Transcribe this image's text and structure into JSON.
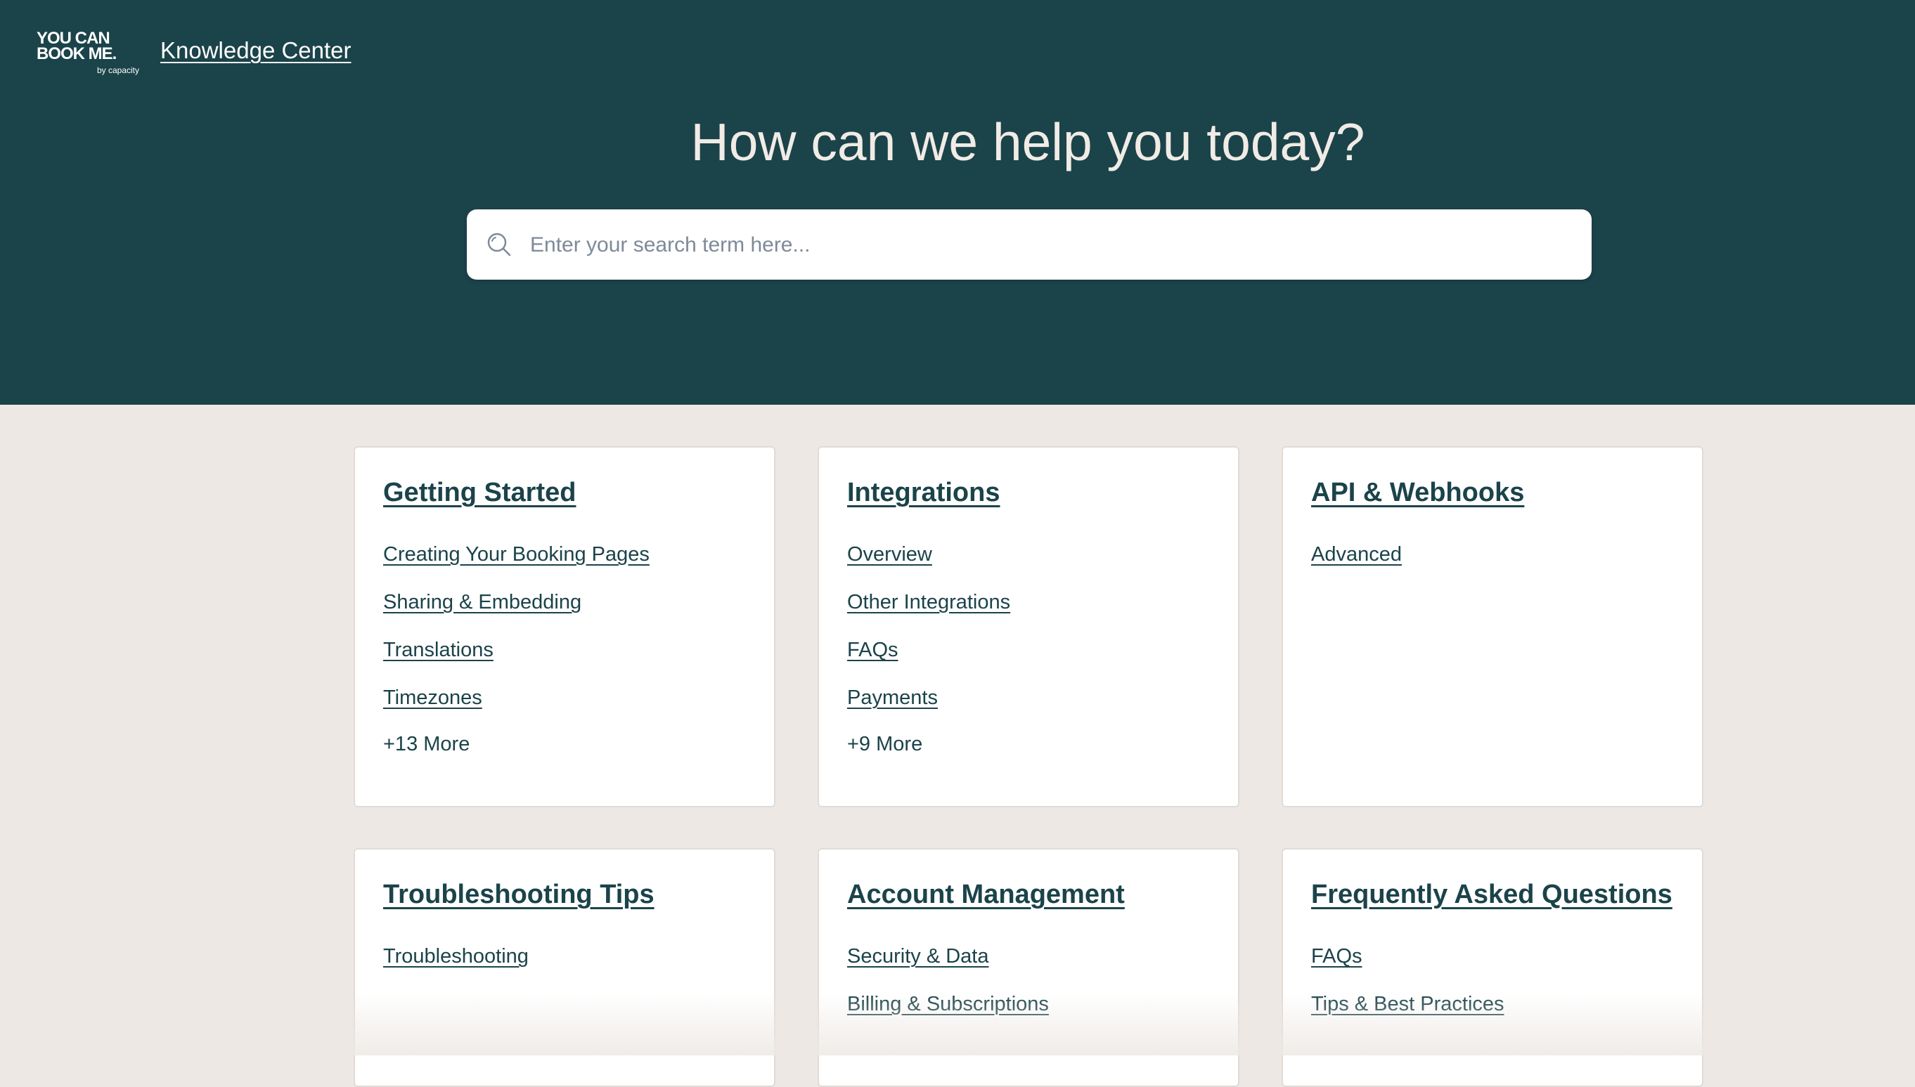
{
  "header": {
    "logo": {
      "line1": "YOU CAN",
      "line2": "BOOK ME.",
      "sub": "by capacity"
    },
    "knowledge_center_link": "Knowledge Center"
  },
  "hero": {
    "title": "How can we help you today?",
    "search": {
      "placeholder": "Enter your search term here...",
      "value": ""
    }
  },
  "colors": {
    "header_bg": "#1b434a",
    "page_bg": "#ede8e4",
    "card_bg": "#ffffff",
    "link": "#1b434a"
  },
  "categories": [
    {
      "title": "Getting Started",
      "links": [
        "Creating Your Booking Pages",
        "Sharing & Embedding",
        "Translations",
        "Timezones"
      ],
      "more": "+13 More"
    },
    {
      "title": "Integrations",
      "links": [
        "Overview",
        "Other Integrations",
        "FAQs",
        "Payments"
      ],
      "more": "+9 More"
    },
    {
      "title": "API & Webhooks",
      "links": [
        "Advanced"
      ],
      "more": ""
    },
    {
      "title": "Troubleshooting Tips",
      "links": [
        "Troubleshooting"
      ],
      "more": ""
    },
    {
      "title": "Account Management",
      "links": [
        "Security & Data",
        "Billing & Subscriptions"
      ],
      "more": ""
    },
    {
      "title": "Frequently Asked Questions",
      "links": [
        "FAQs",
        "Tips & Best Practices"
      ],
      "more": ""
    }
  ]
}
